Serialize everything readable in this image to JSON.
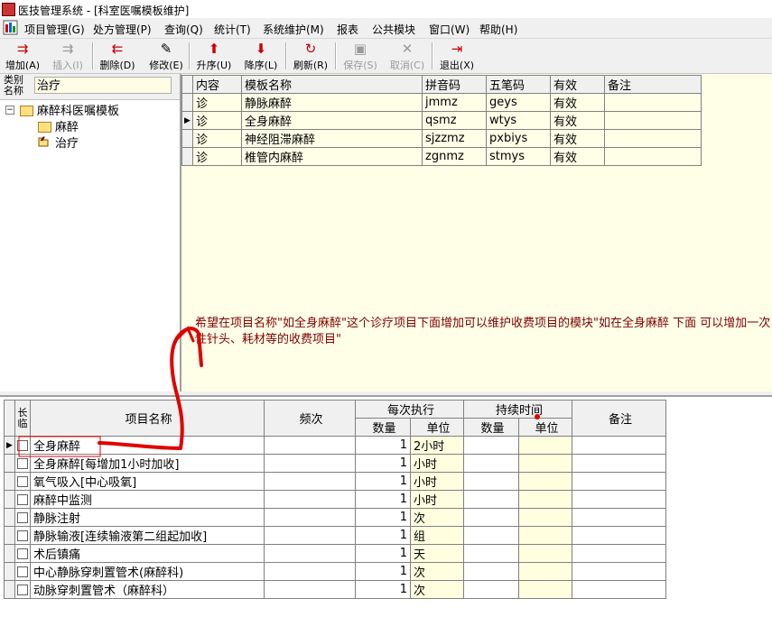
{
  "window": {
    "title": "医技管理系统 - [科室医嘱模板维护]"
  },
  "menu": [
    "项目管理(G)",
    "处方管理(P)",
    "查询(Q)",
    "统计(T)",
    "系统维护(M)",
    "报表",
    "公共模块",
    "窗口(W)",
    "帮助(H)"
  ],
  "toolbar": [
    {
      "label": "增加(A)",
      "icon": "add-icon",
      "enabled": true
    },
    {
      "label": "插入(I)",
      "icon": "insert-icon",
      "enabled": false
    },
    {
      "label": "删除(D)",
      "icon": "delete-icon",
      "enabled": true
    },
    {
      "label": "修改(E)",
      "icon": "edit-icon",
      "enabled": true
    },
    {
      "label": "升序(U)",
      "icon": "arrow-up-icon",
      "enabled": true
    },
    {
      "label": "降序(L)",
      "icon": "arrow-down-icon",
      "enabled": true
    },
    {
      "label": "刷新(R)",
      "icon": "refresh-icon",
      "enabled": true
    },
    {
      "label": "保存(S)",
      "icon": "save-icon",
      "enabled": false
    },
    {
      "label": "取消(C)",
      "icon": "cancel-icon",
      "enabled": false
    },
    {
      "label": "退出(X)",
      "icon": "exit-icon",
      "enabled": true
    }
  ],
  "category": {
    "label_line1": "类别",
    "label_line2": "名称",
    "value": "治疗"
  },
  "tree": {
    "root": "麻醉科医嘱模板",
    "children": [
      "麻醉",
      "治疗"
    ]
  },
  "templates": {
    "headers": [
      "内容",
      "模板名称",
      "拼音码",
      "五笔码",
      "有效",
      "备注"
    ],
    "rows": [
      {
        "content": "诊",
        "name": "静脉麻醉",
        "pinyin": "jmmz",
        "wubi": "geys",
        "valid": "有效",
        "note": ""
      },
      {
        "content": "诊",
        "name": "全身麻醉",
        "pinyin": "qsmz",
        "wubi": "wtys",
        "valid": "有效",
        "note": ""
      },
      {
        "content": "诊",
        "name": "神经阻滞麻醉",
        "pinyin": "sjzzmz",
        "wubi": "pxbiys",
        "valid": "有效",
        "note": ""
      },
      {
        "content": "诊",
        "name": "椎管内麻醉",
        "pinyin": "zgnmz",
        "wubi": "stmys",
        "valid": "有效",
        "note": ""
      }
    ]
  },
  "annotation_note": "希望在项目名称\"如全身麻醉\"这个诊疗项目下面增加可以维护收费项目的模块\"如在全身麻醉  下面  可以增加一次性针头、耗材等的收费项目\"",
  "items": {
    "headers": {
      "long_temp": "长临",
      "name": "项目名称",
      "freq": "频次",
      "per_exec": "每次执行",
      "duration": "持续时间",
      "qty": "数量",
      "unit": "单位",
      "dur_qty": "数量",
      "dur_unit": "单位",
      "note": "备注"
    },
    "rows": [
      {
        "name": "全身麻醉",
        "qty": "1",
        "unit": "2小时"
      },
      {
        "name": "全身麻醉[每增加1小时加收]",
        "qty": "1",
        "unit": "小时"
      },
      {
        "name": "氧气吸入[中心吸氧]",
        "qty": "1",
        "unit": "小时"
      },
      {
        "name": "麻醉中监测",
        "qty": "1",
        "unit": "小时"
      },
      {
        "name": "静脉注射",
        "qty": "1",
        "unit": "次"
      },
      {
        "name": "静脉输液[连续输液第二组起加收]",
        "qty": "1",
        "unit": "组"
      },
      {
        "name": "术后镇痛",
        "qty": "1",
        "unit": "天"
      },
      {
        "name": "中心静脉穿刺置管术(麻醉科)",
        "qty": "1",
        "unit": "次"
      },
      {
        "name": "动脉穿刺置管术（麻醉科）",
        "qty": "1",
        "unit": "次"
      }
    ]
  },
  "colors": {
    "annotation": "#e00000",
    "grid_bg": "#ffffe8",
    "note_text": "#800000"
  }
}
